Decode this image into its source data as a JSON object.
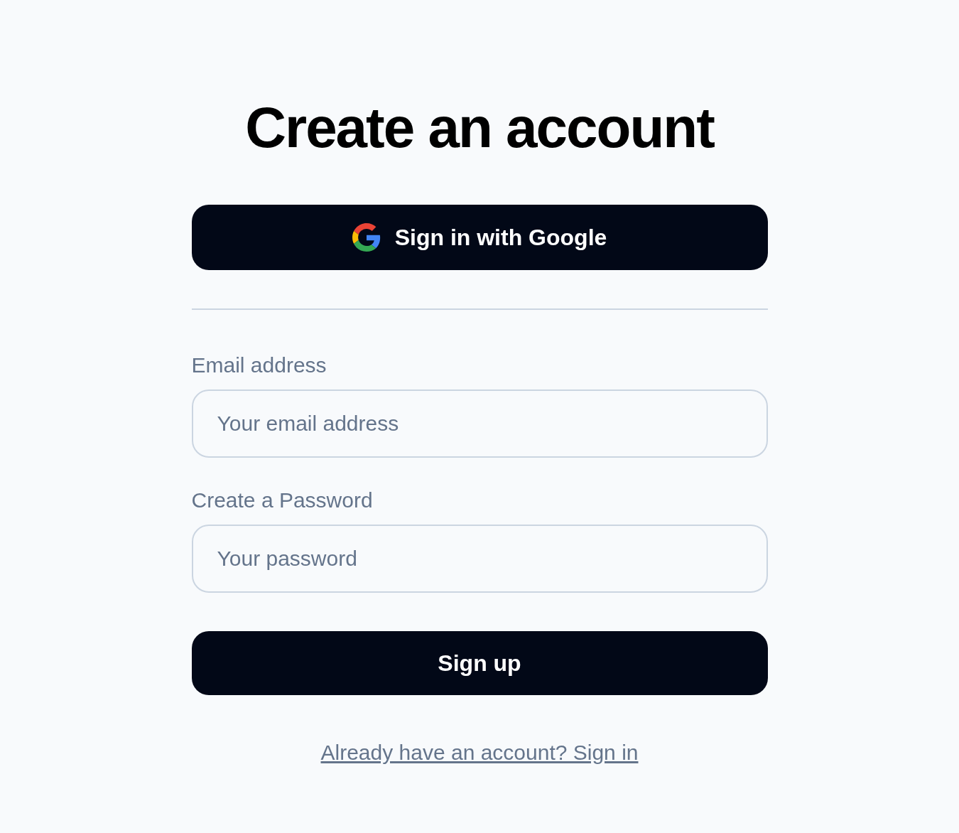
{
  "title": "Create an account",
  "google_button": {
    "label": "Sign in with Google"
  },
  "fields": [
    {
      "label": "Email address",
      "placeholder": "Your email address"
    },
    {
      "label": "Create a Password",
      "placeholder": "Your password"
    }
  ],
  "submit_button": {
    "label": "Sign up"
  },
  "signin_link": "Already have an account? Sign in"
}
